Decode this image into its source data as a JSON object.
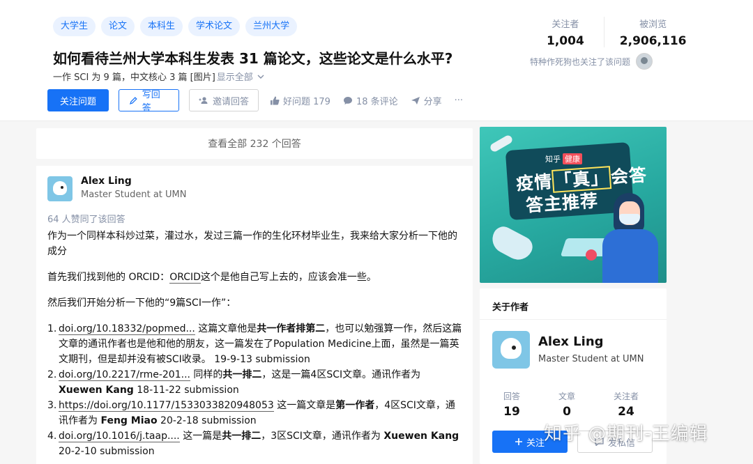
{
  "question": {
    "topics": [
      "大学生",
      "论文",
      "本科生",
      "学术论文",
      "兰州大学"
    ],
    "title": "如何看待兰州大学本科生发表 31 篇论文，这些论文是什么水平?",
    "detail": "一作 SCI 为 9 篇，中文核心 3 篇 [图片]",
    "show_all": "显示全部",
    "follow_label": "关注问题",
    "write_label": "写回答",
    "invite_label": "邀请回答",
    "good_question": "好问题 179",
    "comments": "18 条评论",
    "share": "分享",
    "more": "···"
  },
  "stats": {
    "followers_label": "关注者",
    "followers": "1,004",
    "views_label": "被浏览",
    "views": "2,906,116",
    "follow_note": "特种作死狗也关注了该问题"
  },
  "view_all": "查看全部 232 个回答",
  "answer": {
    "author_name": "Alex Ling",
    "author_bio": "Master Student at UMN",
    "votes": "64 人赞同了该回答",
    "p1": "作为一个同样本科炒过菜，灌过水，发过三篇一作的生化环材毕业生，我来给大家分析一下他的成分",
    "p2_a": "首先我们找到他的 ORCID：",
    "p2_link": "ORCID",
    "p2_b": "这个是他自己写上去的，应该会准一些。",
    "p3": "然后我们开始分析一下他的“9篇SCI一作”：",
    "items": [
      {
        "num": "1.",
        "link": "doi.org/10.18332/popmed...",
        "t1": " 这篇文章他是",
        "b1": "共一作者排第二",
        "t2": "，也可以勉强算一作，然后这篇文章的通讯作者也是他和他的朋友，这一篇发在了Population Medicine上面，虽然是一篇英文期刊，但是却并没有被SCI收录。 19-9-13 submission"
      },
      {
        "num": "2.",
        "link": "doi.org/10.2217/rme-201...",
        "t1": " 同样的",
        "b1": "共一排二",
        "t2": "，这是一篇4区SCI文章。通讯作者为",
        "b2": "Xuewen Kang",
        "t3": " 18-11-22 submission"
      },
      {
        "num": "3.",
        "link": "https://doi.org/10.1177/1533033820948053",
        "t1": " 这一篇文章是",
        "b1": "第一作者",
        "t2": "，4区SCI文章，通讯作者为 ",
        "b2": "Feng Miao",
        "t3": " 20-2-18 submission"
      },
      {
        "num": "4.",
        "link": "doi.org/10.1016/j.taap....",
        "t1": " 这一篇是",
        "b1": "共一排二",
        "t2": "，3区SCI文章，通讯作者为 ",
        "b2": "Xuewen Kang",
        "t3": " 20-2-10 submission"
      }
    ]
  },
  "banner": {
    "brand": "知乎",
    "tag": "健康",
    "line1_a": "疫情",
    "line1_box": "「真」",
    "line1_b": "会答",
    "line2": "答主推荐"
  },
  "about": {
    "heading": "关于作者",
    "name": "Alex Ling",
    "bio": "Master Student at UMN",
    "answers_label": "回答",
    "answers": "19",
    "articles_label": "文章",
    "articles": "0",
    "followers_label": "关注者",
    "followers": "24",
    "follow_btn": "关注",
    "message_btn": "发私信"
  },
  "watermark": "知乎 @期刊-王编辑",
  "colors": {
    "accent": "#1772f6",
    "topic_bg": "#eaf2ff",
    "muted": "#8590a6"
  }
}
